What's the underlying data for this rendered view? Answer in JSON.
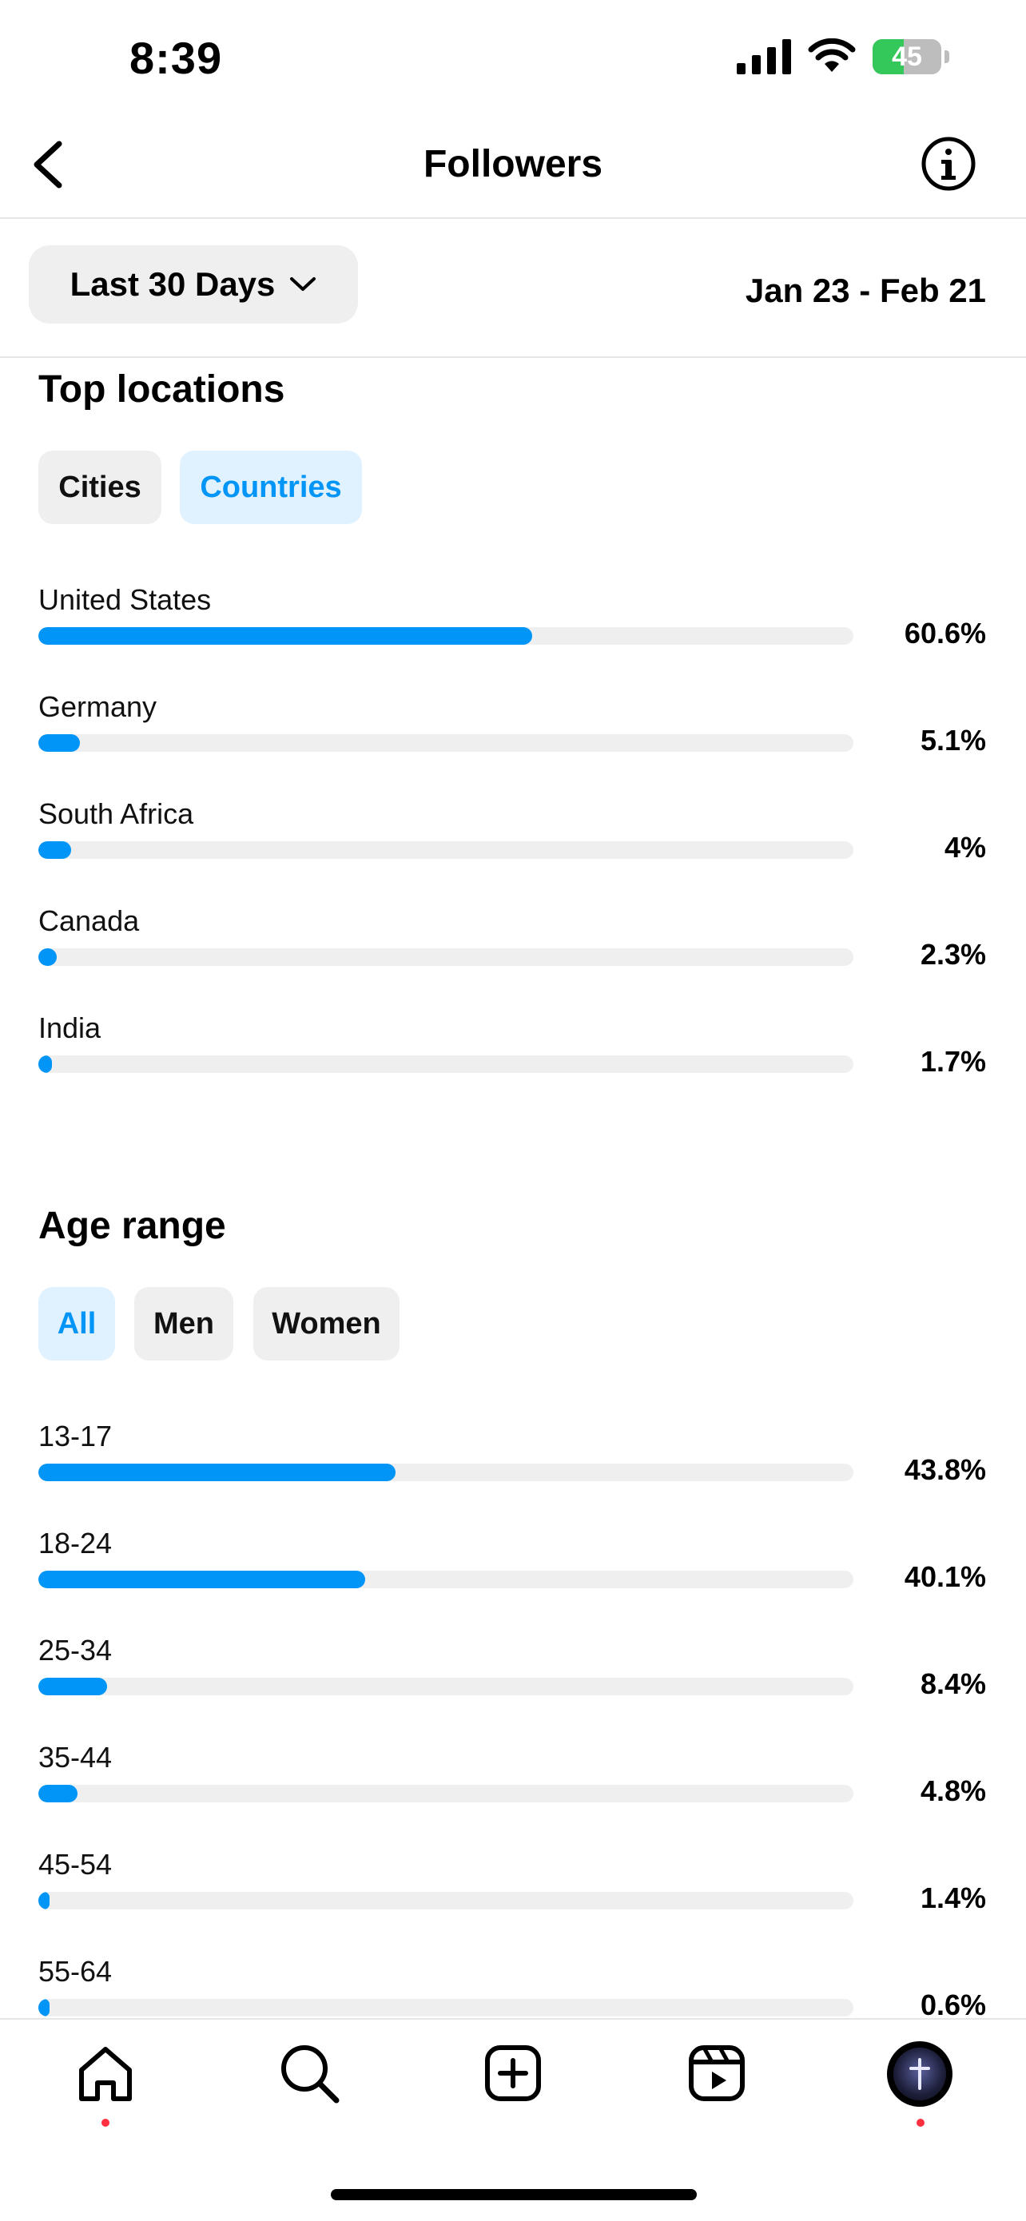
{
  "status_bar": {
    "time": "8:39",
    "battery": "45",
    "battery_level_percent": 45
  },
  "header": {
    "title": "Followers"
  },
  "date_row": {
    "range_button_label": "Last 30 Days",
    "date_range": "Jan 23 - Feb 21"
  },
  "top_locations": {
    "title": "Top locations",
    "tabs": [
      {
        "label": "Cities",
        "active": false
      },
      {
        "label": "Countries",
        "active": true
      }
    ],
    "rows": [
      {
        "label": "United States",
        "value_text": "60.6%",
        "value": 60.6
      },
      {
        "label": "Germany",
        "value_text": "5.1%",
        "value": 5.1
      },
      {
        "label": "South Africa",
        "value_text": "4%",
        "value": 4.0
      },
      {
        "label": "Canada",
        "value_text": "2.3%",
        "value": 2.3
      },
      {
        "label": "India",
        "value_text": "1.7%",
        "value": 1.7
      }
    ]
  },
  "age_range": {
    "title": "Age range",
    "tabs": [
      {
        "label": "All",
        "active": true
      },
      {
        "label": "Men",
        "active": false
      },
      {
        "label": "Women",
        "active": false
      }
    ],
    "rows": [
      {
        "label": "13-17",
        "value_text": "43.8%",
        "value": 43.8
      },
      {
        "label": "18-24",
        "value_text": "40.1%",
        "value": 40.1
      },
      {
        "label": "25-34",
        "value_text": "8.4%",
        "value": 8.4
      },
      {
        "label": "35-44",
        "value_text": "4.8%",
        "value": 4.8
      },
      {
        "label": "45-54",
        "value_text": "1.4%",
        "value": 1.4
      },
      {
        "label": "55-64",
        "value_text": "0.6%",
        "value": 0.6
      }
    ]
  },
  "tab_bar": {
    "items": [
      {
        "name": "home",
        "icon": "home-icon",
        "notification_dot": true
      },
      {
        "name": "search",
        "icon": "search-icon",
        "notification_dot": false
      },
      {
        "name": "create",
        "icon": "add-post-icon",
        "notification_dot": false
      },
      {
        "name": "reels",
        "icon": "reels-icon",
        "notification_dot": false
      },
      {
        "name": "profile",
        "icon": "avatar",
        "notification_dot": true
      }
    ]
  },
  "colors": {
    "accent": "#0095f6",
    "track": "#efefef",
    "chip_active_bg": "#e0f1ff",
    "notification": "#ff3040",
    "battery": "#34c759"
  }
}
